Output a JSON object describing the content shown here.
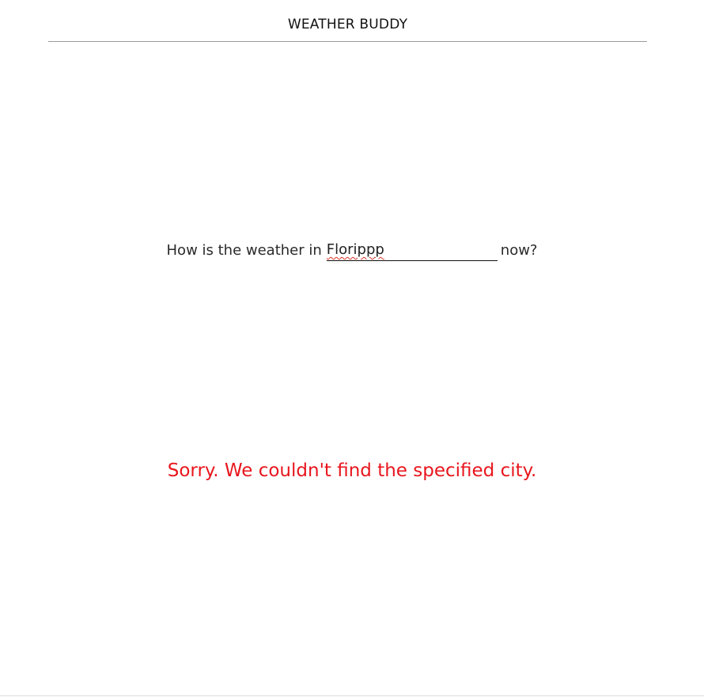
{
  "header": {
    "title": "WEATHER BUDDY"
  },
  "query": {
    "prefix": "How is the weather in",
    "city_value": "Florippp",
    "suffix": "now?"
  },
  "error": {
    "message": "Sorry. We couldn't find the specified city."
  },
  "colors": {
    "text": "#222222",
    "error": "#e8161d",
    "divider": "#9a9a9a",
    "spellcheck_underline": "#d93025"
  }
}
